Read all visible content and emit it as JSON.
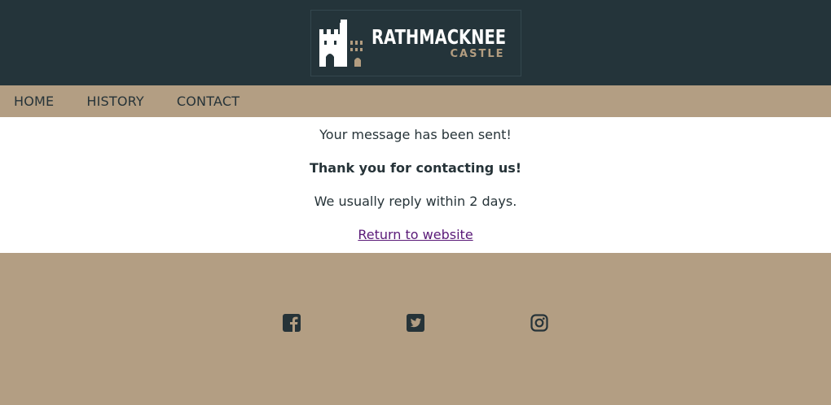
{
  "header": {
    "logo_title": "RATHMACKNEE",
    "logo_subtitle": "CASTLE"
  },
  "nav": {
    "items": [
      {
        "label": "HOME"
      },
      {
        "label": "HISTORY"
      },
      {
        "label": "CONTACT"
      }
    ]
  },
  "main": {
    "sent_message": "Your message has been sent!",
    "thanks_message": "Thank you for contacting us!",
    "reply_message": "We usually reply within 2 days.",
    "return_link": "Return to website"
  },
  "footer": {
    "social": [
      "facebook-icon",
      "twitter-icon",
      "instagram-icon"
    ]
  },
  "colors": {
    "header_bg": "#24343a",
    "accent_tan": "#b39e83",
    "text_dark": "#263338",
    "link": "#5a1a78"
  }
}
